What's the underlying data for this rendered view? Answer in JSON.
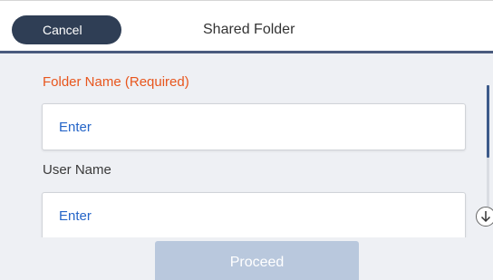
{
  "header": {
    "cancel_label": "Cancel",
    "title": "Shared Folder"
  },
  "form": {
    "folder_name_label": "Folder Name (Required)",
    "folder_name_placeholder": "Enter",
    "user_name_label": "User Name",
    "user_name_placeholder": "Enter"
  },
  "scroll": {
    "down_icon": "arrow-down-circle-icon"
  },
  "footer": {
    "proceed_label": "Proceed"
  },
  "colors": {
    "required_label": "#e8561d",
    "placeholder_text": "#2565c8",
    "cancel_button": "#2f3e55",
    "proceed_disabled": "#b9c8dd",
    "panel_background": "#eef0f4"
  }
}
